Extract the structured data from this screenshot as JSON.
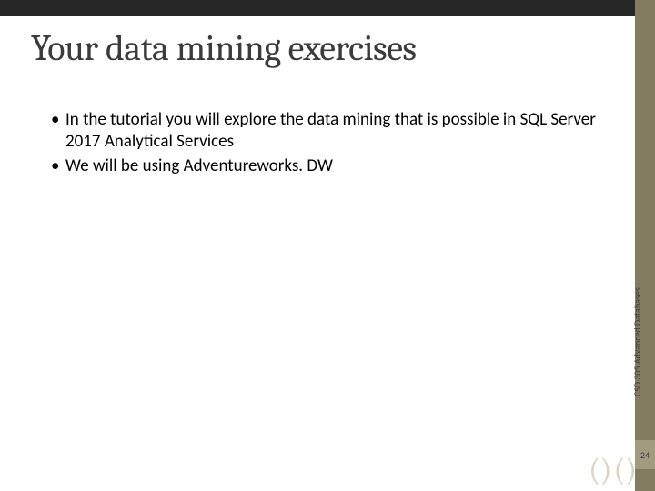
{
  "title": "Your data mining exercises",
  "bullets": [
    "In the tutorial you will explore the data mining that is possible in SQL Server 2017 Analytical Services",
    "We will be using Adventureworks. DW"
  ],
  "side_caption": "CSD 305 Advanced Databases",
  "page_number": "24",
  "decor": {
    "left": "( )",
    "right": "( )"
  }
}
